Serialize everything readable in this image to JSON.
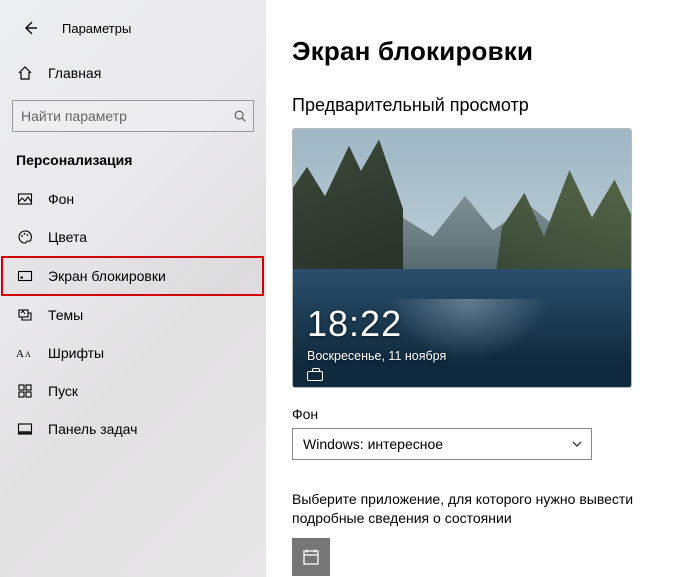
{
  "header": {
    "title": "Параметры"
  },
  "home": {
    "label": "Главная"
  },
  "search": {
    "placeholder": "Найти параметр"
  },
  "group": {
    "label": "Персонализация"
  },
  "nav": [
    {
      "label": "Фон"
    },
    {
      "label": "Цвета"
    },
    {
      "label": "Экран блокировки"
    },
    {
      "label": "Темы"
    },
    {
      "label": "Шрифты"
    },
    {
      "label": "Пуск"
    },
    {
      "label": "Панель задач"
    }
  ],
  "page": {
    "title": "Экран блокировки",
    "preview_label": "Предварительный просмотр",
    "lock_time": "18:22",
    "lock_date": "Воскресенье, 11 ноября",
    "bg_field_label": "Фон",
    "bg_value": "Windows: интересное",
    "app_hint": "Выберите приложение, для которого нужно вывести подробные сведения о состоянии"
  }
}
